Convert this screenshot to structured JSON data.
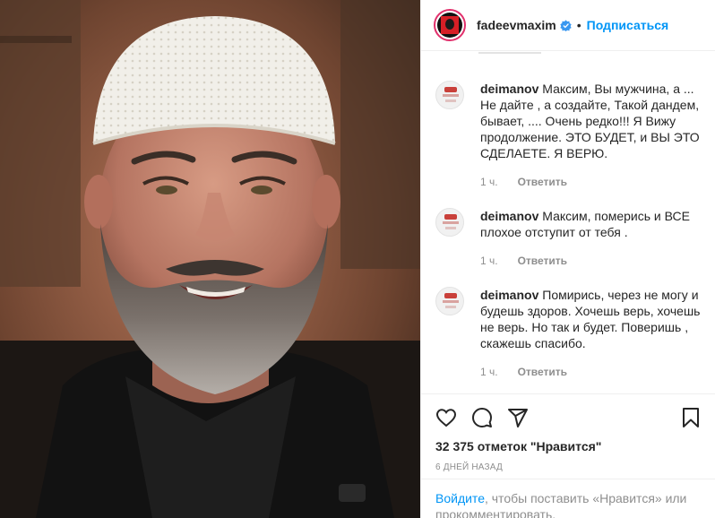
{
  "post": {
    "image_description": "photo"
  },
  "header": {
    "username": "fadeevmaxim",
    "verified_icon": "verified-badge-icon",
    "separator": "•",
    "follow_label": "Подписаться"
  },
  "comments": [
    {
      "username": "deimanov",
      "text": "Максим, Вы мужчина, а ... Не дайте , а создайте, Такой дандем, бывает, .... Очень редко!!! Я Вижу продолжение. ЭТО БУДЕТ, и ВЫ ЭТО СДЕЛАЕТЕ. Я ВЕРЮ.",
      "time": "1 ч.",
      "reply_label": "Ответить"
    },
    {
      "username": "deimanov",
      "text": "Максим, померись и ВСЕ плохое отступит от тебя .",
      "time": "1 ч.",
      "reply_label": "Ответить"
    },
    {
      "username": "deimanov",
      "text": "Помирись, через не могу и будешь здоров. Хочешь верь, хочешь не верь. Но так и будет. Поверишь , скажешь спасибо.",
      "time": "1 ч.",
      "reply_label": "Ответить"
    }
  ],
  "actions": {
    "icons": [
      "heart-icon",
      "comment-icon",
      "share-icon",
      "bookmark-icon"
    ],
    "likes_text": "32 375 отметок \"Нравится\"",
    "posted_time": "6 ДНЕЙ НАЗАД"
  },
  "login_prompt": {
    "link": "Войдите",
    "text": ", чтобы поставить «Нравится» или прокомментировать."
  },
  "colors": {
    "accent": "#0095f6",
    "text": "#262626",
    "muted": "#8e8e8e",
    "border": "#efefef"
  }
}
